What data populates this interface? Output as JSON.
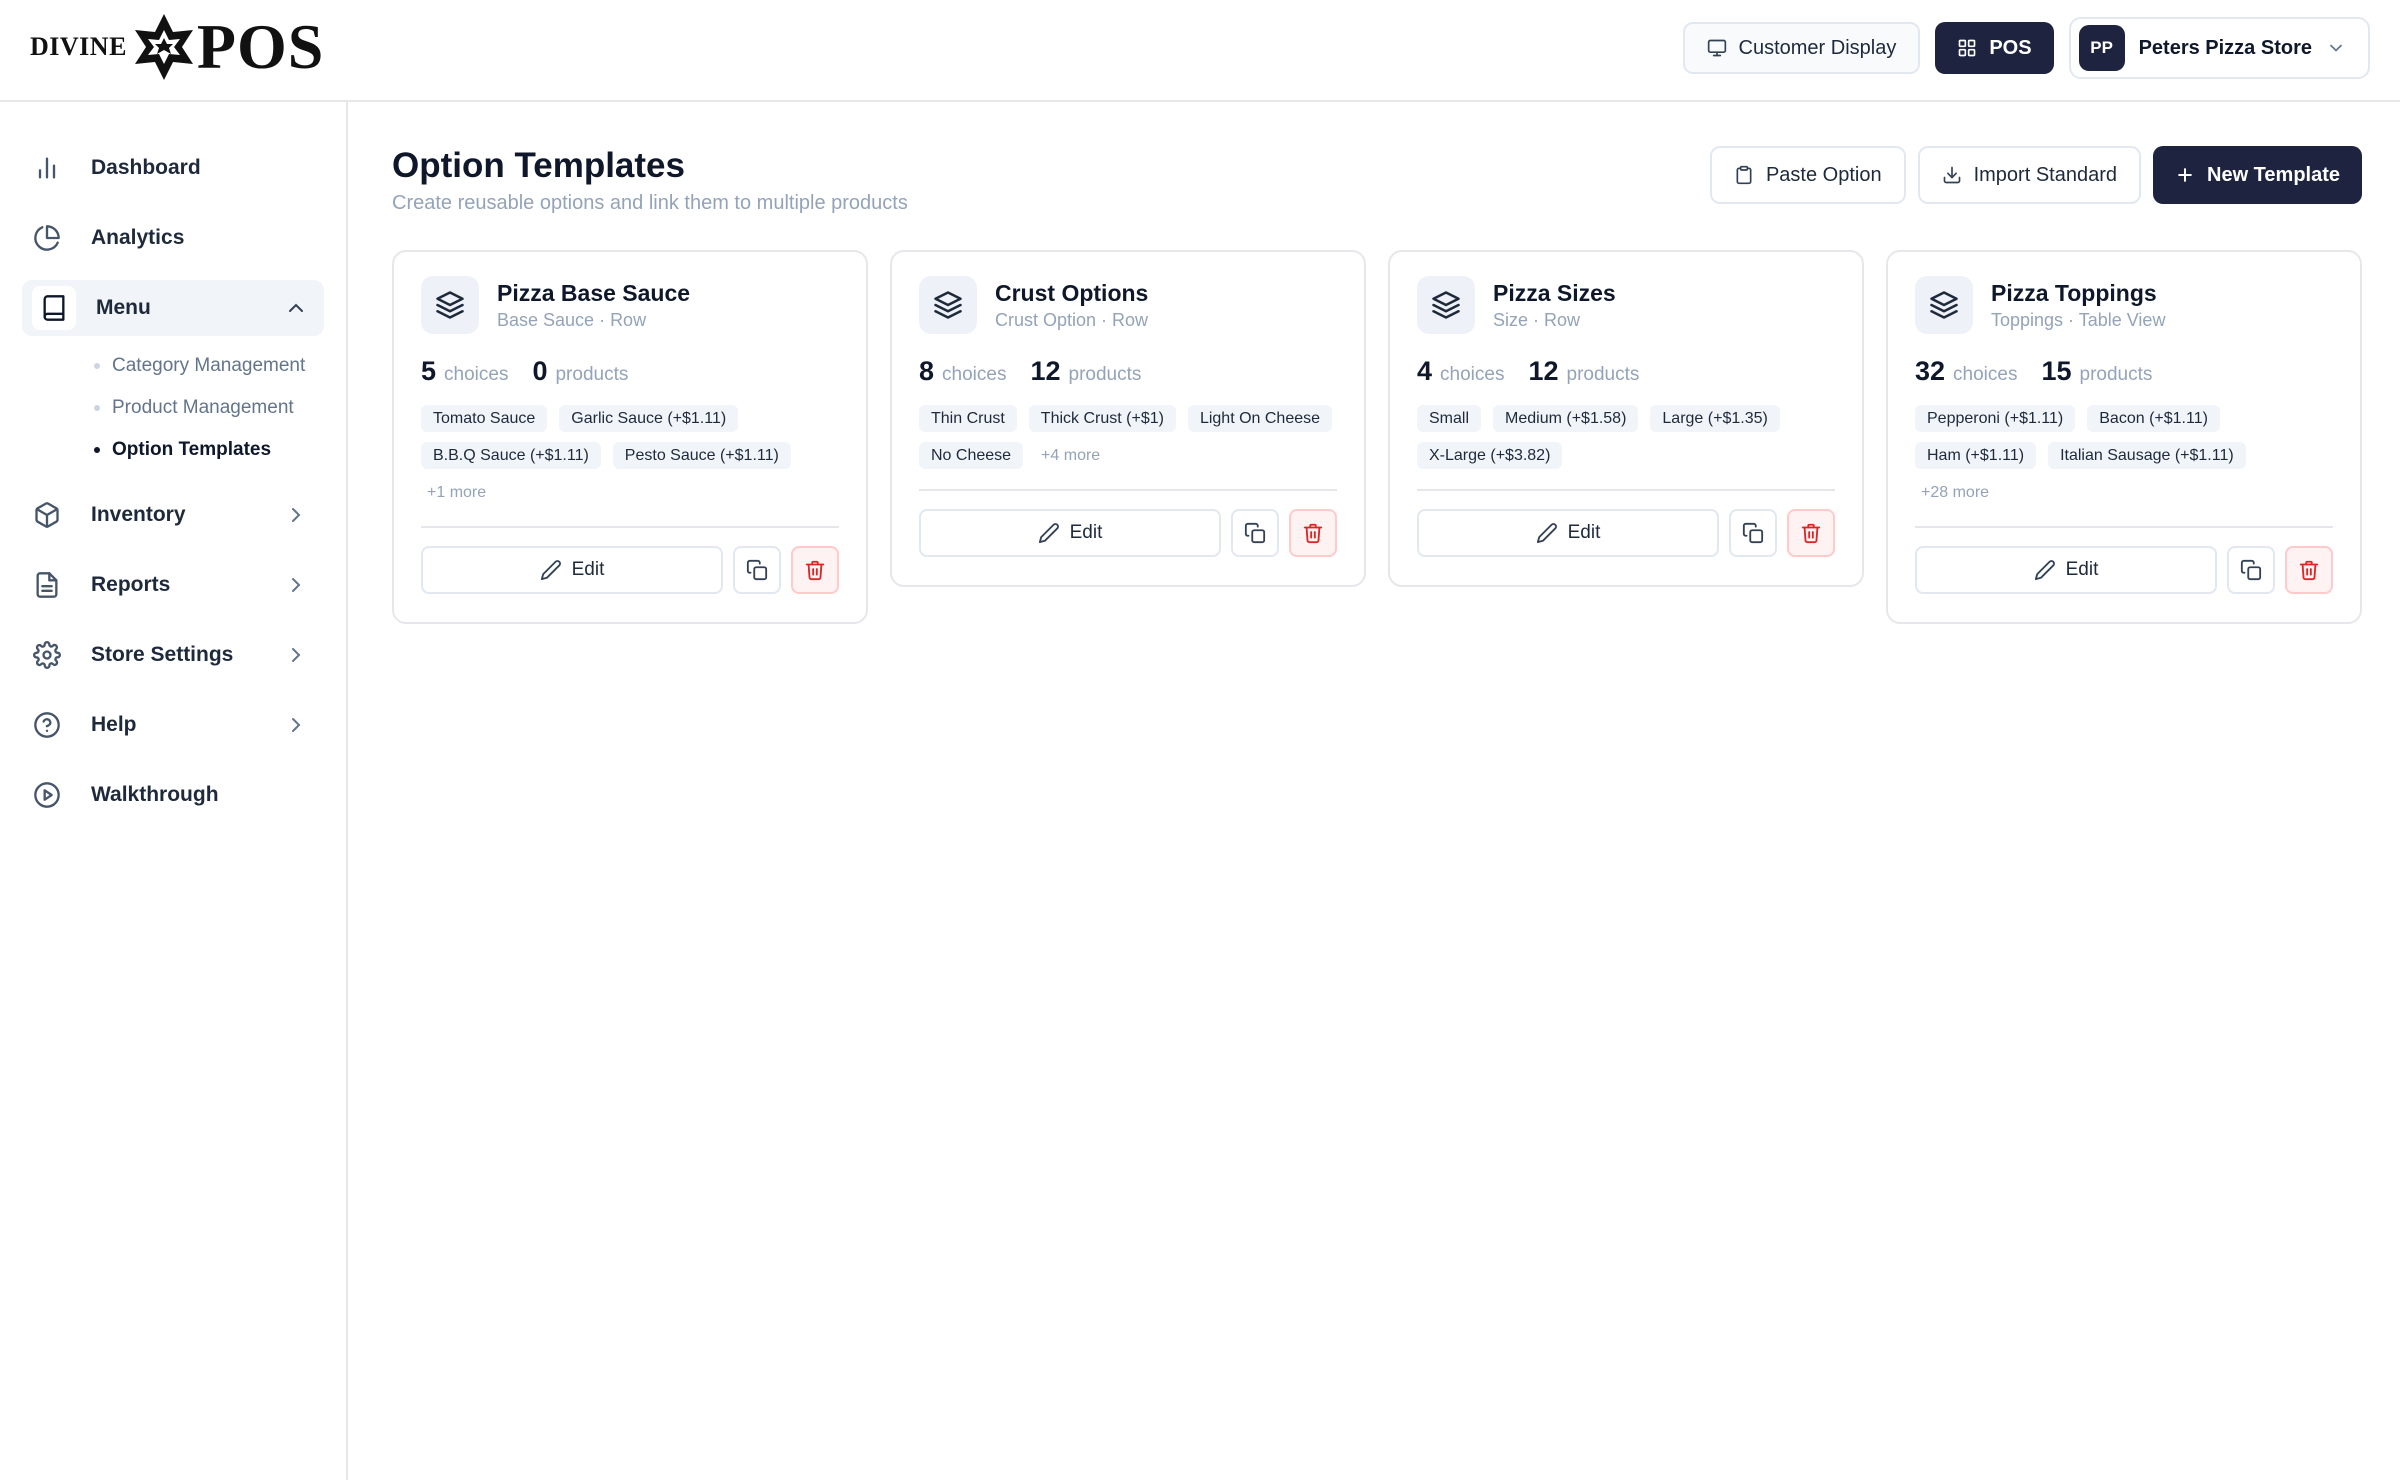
{
  "brand": {
    "word_left": "DIVINE",
    "word_right": "POS"
  },
  "topbar": {
    "customer_display_label": "Customer Display",
    "pos_label": "POS",
    "store_initials": "PP",
    "store_name": "Peters Pizza Store"
  },
  "sidebar": {
    "items": [
      {
        "label": "Dashboard",
        "icon": "bar-chart-icon"
      },
      {
        "label": "Analytics",
        "icon": "pie-chart-icon"
      },
      {
        "label": "Menu",
        "icon": "book-icon"
      },
      {
        "label": "Inventory",
        "icon": "box-icon"
      },
      {
        "label": "Reports",
        "icon": "file-text-icon"
      },
      {
        "label": "Store Settings",
        "icon": "gear-icon"
      },
      {
        "label": "Help",
        "icon": "help-circle-icon"
      },
      {
        "label": "Walkthrough",
        "icon": "play-circle-icon"
      }
    ],
    "menu_sub": [
      "Category Management",
      "Product Management",
      "Option Templates"
    ]
  },
  "page": {
    "title": "Option Templates",
    "subtitle": "Create reusable options and link them to multiple products",
    "paste_label": "Paste Option",
    "import_label": "Import Standard",
    "new_label": "New Template"
  },
  "labels": {
    "choices": "choices",
    "products": "products",
    "edit": "Edit"
  },
  "cards": [
    {
      "title": "Pizza Base Sauce",
      "meta": "Base Sauce · Row",
      "choices": "5",
      "products": "0",
      "chips": [
        "Tomato Sauce",
        "Garlic Sauce (+$1.11)",
        "B.B.Q Sauce (+$1.11)",
        "Pesto Sauce (+$1.11)"
      ],
      "more": "+1 more"
    },
    {
      "title": "Crust Options",
      "meta": "Crust Option · Row",
      "choices": "8",
      "products": "12",
      "chips": [
        "Thin Crust",
        "Thick Crust (+$1)",
        "Light On Cheese",
        "No Cheese"
      ],
      "more": "+4 more"
    },
    {
      "title": "Pizza Sizes",
      "meta": "Size · Row",
      "choices": "4",
      "products": "12",
      "chips": [
        "Small",
        "Medium (+$1.58)",
        "Large (+$1.35)",
        "X-Large (+$3.82)"
      ],
      "more": ""
    },
    {
      "title": "Pizza Toppings",
      "meta": "Toppings · Table View",
      "choices": "32",
      "products": "15",
      "chips": [
        "Pepperoni (+$1.11)",
        "Bacon (+$1.11)",
        "Ham (+$1.11)",
        "Italian Sausage (+$1.11)"
      ],
      "more": "+28 more"
    }
  ],
  "colors": {
    "primary": "#1e2340",
    "danger": "#dc2626",
    "muted": "#94a3b8",
    "chip_bg": "#f1f5f9"
  }
}
